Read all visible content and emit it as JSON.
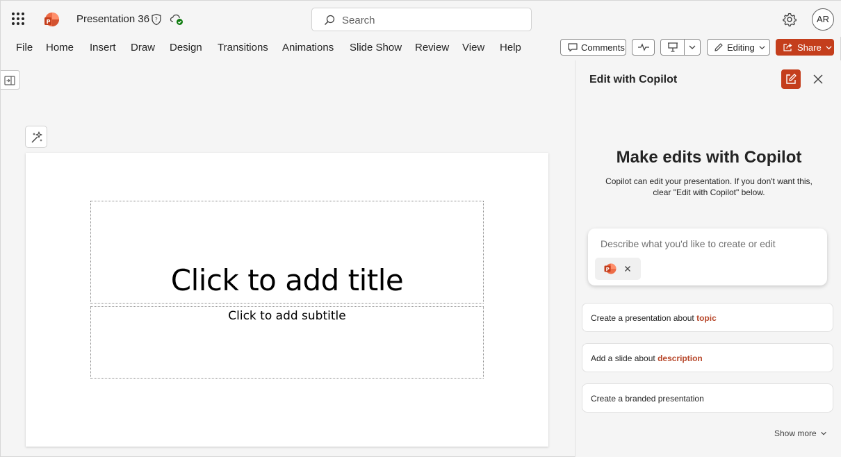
{
  "app": {
    "document_title": "Presentation 36",
    "accent_color": "#c43e1c",
    "keyword_color": "#b7472a"
  },
  "search": {
    "placeholder": "Search"
  },
  "account": {
    "initials": "AR"
  },
  "ribbon": {
    "tabs": [
      "File",
      "Home",
      "Insert",
      "Draw",
      "Design",
      "Transitions",
      "Animations",
      "Slide Show",
      "Review",
      "View",
      "Help"
    ],
    "comments_label": "Comments",
    "editing_label": "Editing",
    "share_label": "Share"
  },
  "slide": {
    "title_placeholder": "Click to add title",
    "subtitle_placeholder": "Click to add subtitle"
  },
  "copilot": {
    "pane_title": "Edit with Copilot",
    "heading": "Make edits with Copilot",
    "description": "Copilot can edit your presentation. If you don't want this, clear \"Edit with Copilot\" below.",
    "prompt_placeholder": "Describe what you'd like to create or edit",
    "suggestions": [
      {
        "text": "Create a presentation about ",
        "keyword": "topic"
      },
      {
        "text": "Add a slide about ",
        "keyword": "description"
      },
      {
        "text": "Create a branded presentation",
        "keyword": ""
      }
    ],
    "show_more_label": "Show more"
  },
  "icons": {
    "launcher": "app-launcher-icon",
    "logo": "powerpoint-logo",
    "sensitivity": "shield-icon",
    "saved": "cloud-check-icon",
    "search": "search-icon",
    "settings": "gear-icon",
    "comments": "comment-icon",
    "catchup": "activity-icon",
    "present": "present-icon",
    "editing": "pencil-icon",
    "share": "share-icon",
    "designer": "designer-sparkle-icon",
    "new_chat": "compose-icon",
    "close": "close-icon"
  }
}
